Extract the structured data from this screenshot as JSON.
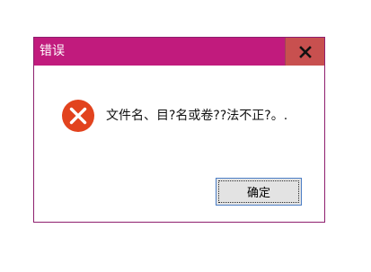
{
  "dialog": {
    "title": "错误",
    "close_label": "x",
    "message": "文件名、目?名或卷??法不正?。.",
    "ok_label": "确定",
    "icon": "error-icon"
  },
  "colors": {
    "titlebar": "#c11b7d",
    "close_button": "#c8504f",
    "border": "#8e1f6e",
    "error_icon": "#e2431e",
    "ok_button_border": "#4c7ec5"
  }
}
